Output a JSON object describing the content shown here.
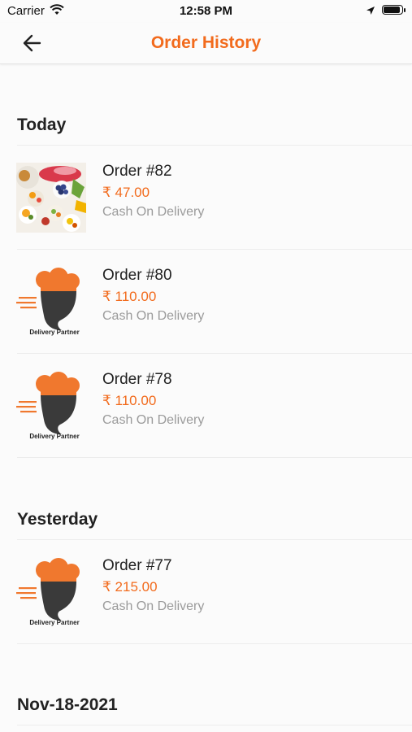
{
  "status_bar": {
    "carrier": "Carrier",
    "time": "12:58 PM"
  },
  "header": {
    "title": "Order History"
  },
  "colors": {
    "accent": "#f26b1d",
    "text": "#222222",
    "muted": "#9b9b9b"
  },
  "sections": [
    {
      "title": "Today"
    },
    {
      "title": "Yesterday"
    },
    {
      "title": "Nov-18-2021"
    }
  ],
  "orders": [
    {
      "number": "Order #82",
      "amount": "₹ 47.00",
      "payment": "Cash On Delivery",
      "image": "food-photo"
    },
    {
      "number": "Order #80",
      "amount": "₹ 110.00",
      "payment": "Cash On Delivery",
      "image": "delivery-partner-logo"
    },
    {
      "number": "Order #78",
      "amount": "₹ 110.00",
      "payment": "Cash On Delivery",
      "image": "delivery-partner-logo"
    },
    {
      "number": "Order #77",
      "amount": "₹ 215.00",
      "payment": "Cash On Delivery",
      "image": "delivery-partner-logo"
    }
  ],
  "logo_text": "Delivery Partner"
}
